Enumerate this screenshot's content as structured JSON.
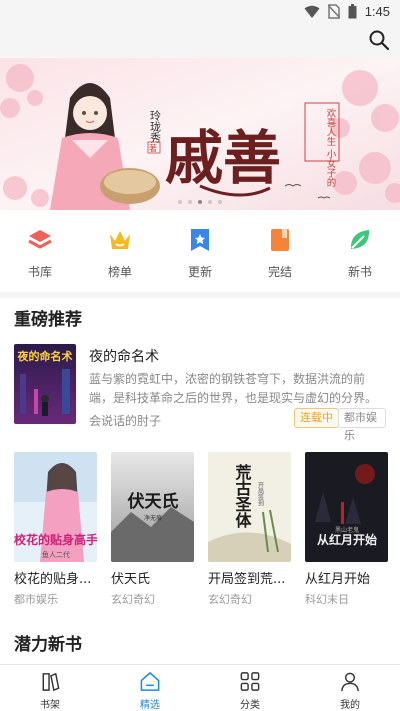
{
  "status_bar": {
    "time": "1:45"
  },
  "header": {
    "search_icon": "search-icon"
  },
  "banner": {
    "author_name": "玲珑秀",
    "author_mark": "著",
    "title": "戚善",
    "tagline": "欢喜人生 小女子的",
    "slide_count": 5,
    "active_slide": 3
  },
  "quick_nav": [
    {
      "label": "书库",
      "icon": "layers-icon",
      "color": "#f0605a"
    },
    {
      "label": "榜单",
      "icon": "crown-icon",
      "color": "#f6b91f"
    },
    {
      "label": "更新",
      "icon": "bookmark-star-icon",
      "color": "#3a86e8"
    },
    {
      "label": "完结",
      "icon": "book-complete-icon",
      "color": "#f5843a"
    },
    {
      "label": "新书",
      "icon": "leaf-icon",
      "color": "#3cc77a"
    }
  ],
  "sections": {
    "recommended": "重磅推荐",
    "potential": "潜力新书"
  },
  "featured": {
    "cover_text": "夜的命名术",
    "title": "夜的命名术",
    "description": "蓝与紫的霓虹中，浓密的钢铁苍穹下，数据洪流的前端，是科技革命之后的世界，也是现实与虚幻的分界。钢铁与身体，过...",
    "author": "会说话的肘子",
    "status_tag": "连载中",
    "genre_tag": "都市娱乐"
  },
  "books": [
    {
      "title": "校花的贴身...",
      "genre": "都市娱乐",
      "cover_text": "校花的贴身高手",
      "cover_sub": "鱼人二代"
    },
    {
      "title": "伏天氏",
      "genre": "玄幻奇幻",
      "cover_text": "伏天氏",
      "cover_sub": "净无痕"
    },
    {
      "title": "开局签到荒...",
      "genre": "玄幻奇幻",
      "cover_text": "荒古圣体",
      "cover_sub": "开局签到"
    },
    {
      "title": "从红月开始",
      "genre": "科幻末日",
      "cover_text": "从红月开始",
      "cover_sub": "黑山老鬼"
    }
  ],
  "bottom_nav": [
    {
      "label": "书架",
      "icon": "bookshelf-icon",
      "active": false
    },
    {
      "label": "精选",
      "icon": "home-icon",
      "active": true
    },
    {
      "label": "分类",
      "icon": "grid-icon",
      "active": false
    },
    {
      "label": "我的",
      "icon": "person-icon",
      "active": false
    }
  ],
  "colors": {
    "accent": "#1e88e5",
    "serial_tag": "#f0a020"
  }
}
